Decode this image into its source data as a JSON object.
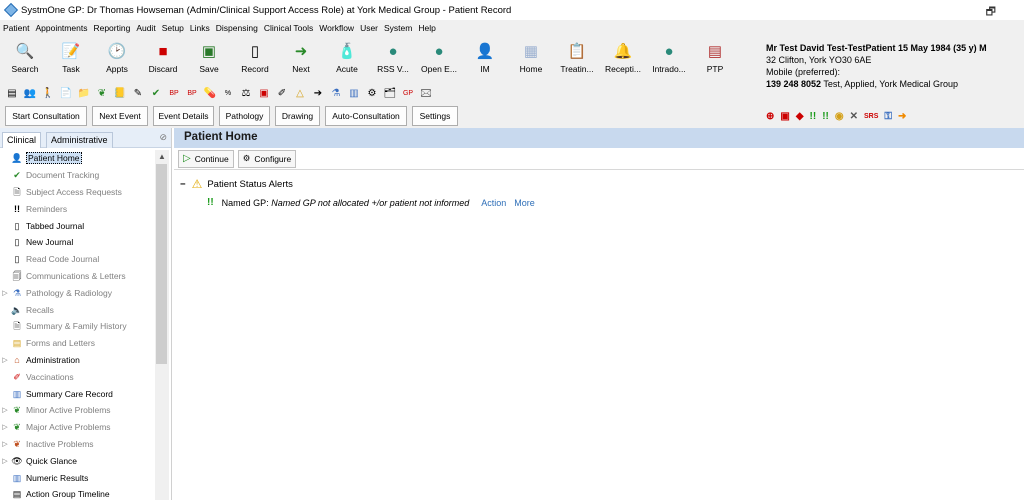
{
  "window": {
    "title": "SystmOne GP: Dr Thomas Howseman (Admin/Clinical Support Access Role) at York Medical Group - Patient Record"
  },
  "menu": [
    "Patient",
    "Appointments",
    "Reporting",
    "Audit",
    "Setup",
    "Links",
    "Dispensing",
    "Clinical Tools",
    "Workflow",
    "User",
    "System",
    "Help"
  ],
  "toolbar": [
    {
      "label": "Search",
      "icon": "magnifier-icon"
    },
    {
      "label": "Task",
      "icon": "task-icon"
    },
    {
      "label": "Appts",
      "icon": "clock-icon"
    },
    {
      "label": "Discard",
      "icon": "discard-icon"
    },
    {
      "label": "Save",
      "icon": "save-icon"
    },
    {
      "label": "Record",
      "icon": "record-icon"
    },
    {
      "label": "Next",
      "icon": "next-icon"
    },
    {
      "label": "Acute",
      "icon": "bottle-icon"
    },
    {
      "label": "RSS V...",
      "icon": "rss-icon"
    },
    {
      "label": "Open E...",
      "icon": "open-icon"
    },
    {
      "label": "IM",
      "icon": "im-icon"
    },
    {
      "label": "Home",
      "icon": "home-icon"
    },
    {
      "label": "Treatin...",
      "icon": "treatment-icon"
    },
    {
      "label": "Recepti...",
      "icon": "bell-icon"
    },
    {
      "label": "Intrado...",
      "icon": "intrado-icon"
    },
    {
      "label": "PTP",
      "icon": "ptp-icon"
    }
  ],
  "buttons": [
    "Start Consultation",
    "Next Event",
    "Event Details",
    "Pathology",
    "Drawing",
    "Auto-Consultation",
    "Settings"
  ],
  "patient": {
    "name_line": "Mr Test David Test-TestPatient 15 May 1984 (35 y) M",
    "address": "32 Clifton, York YO30 6AE",
    "mobile": "Mobile (preferred):",
    "id_line": "139 248 8052",
    "id_rest": "Test, Applied, York Medical Group"
  },
  "tabs": {
    "clinical": "Clinical",
    "administrative": "Administrative"
  },
  "nav": [
    {
      "label": "Patient Home",
      "gray": false,
      "sel": true,
      "arrow": false,
      "icon": "person-icon"
    },
    {
      "label": "Document Tracking",
      "gray": true,
      "arrow": false,
      "icon": "tick-icon"
    },
    {
      "label": "Subject Access Requests",
      "gray": true,
      "arrow": false,
      "icon": "file-icon"
    },
    {
      "label": "Reminders",
      "gray": true,
      "arrow": false,
      "icon": "exclaim-icon"
    },
    {
      "label": "Tabbed Journal",
      "gray": false,
      "arrow": false,
      "icon": "journal-icon"
    },
    {
      "label": "New Journal",
      "gray": false,
      "arrow": false,
      "icon": "journal-icon"
    },
    {
      "label": "Read Code Journal",
      "gray": true,
      "arrow": false,
      "icon": "journal-icon"
    },
    {
      "label": "Communications & Letters",
      "gray": true,
      "arrow": false,
      "icon": "letters-icon"
    },
    {
      "label": "Pathology & Radiology",
      "gray": true,
      "arrow": true,
      "icon": "flask-icon"
    },
    {
      "label": "Recalls",
      "gray": true,
      "arrow": false,
      "icon": "speaker-icon"
    },
    {
      "label": "Summary & Family History",
      "gray": true,
      "arrow": false,
      "icon": "summary-icon"
    },
    {
      "label": "Forms and Letters",
      "gray": true,
      "arrow": false,
      "icon": "forms-icon"
    },
    {
      "label": "Administration",
      "gray": false,
      "arrow": true,
      "icon": "house-icon"
    },
    {
      "label": "Vaccinations",
      "gray": true,
      "arrow": false,
      "icon": "syringe-icon"
    },
    {
      "label": "Summary Care Record",
      "gray": false,
      "arrow": false,
      "icon": "scr-icon"
    },
    {
      "label": "Minor Active Problems",
      "gray": true,
      "arrow": true,
      "icon": "problem-icon"
    },
    {
      "label": "Major Active Problems",
      "gray": true,
      "arrow": true,
      "icon": "problem-icon"
    },
    {
      "label": "Inactive Problems",
      "gray": true,
      "arrow": true,
      "icon": "inactive-icon"
    },
    {
      "label": "Quick Glance",
      "gray": false,
      "arrow": true,
      "icon": "eye-icon"
    },
    {
      "label": "Numeric Results",
      "gray": false,
      "arrow": false,
      "icon": "chart-icon"
    },
    {
      "label": "Action Group Timeline",
      "gray": false,
      "arrow": false,
      "icon": "timeline-icon"
    }
  ],
  "main": {
    "title": "Patient Home",
    "continue": "Continue",
    "configure": "Configure",
    "alert_header": "Patient Status Alerts",
    "alert_label": "Named GP:",
    "alert_text": "Named GP not allocated +/or patient not informed",
    "action": "Action",
    "more": "More"
  }
}
